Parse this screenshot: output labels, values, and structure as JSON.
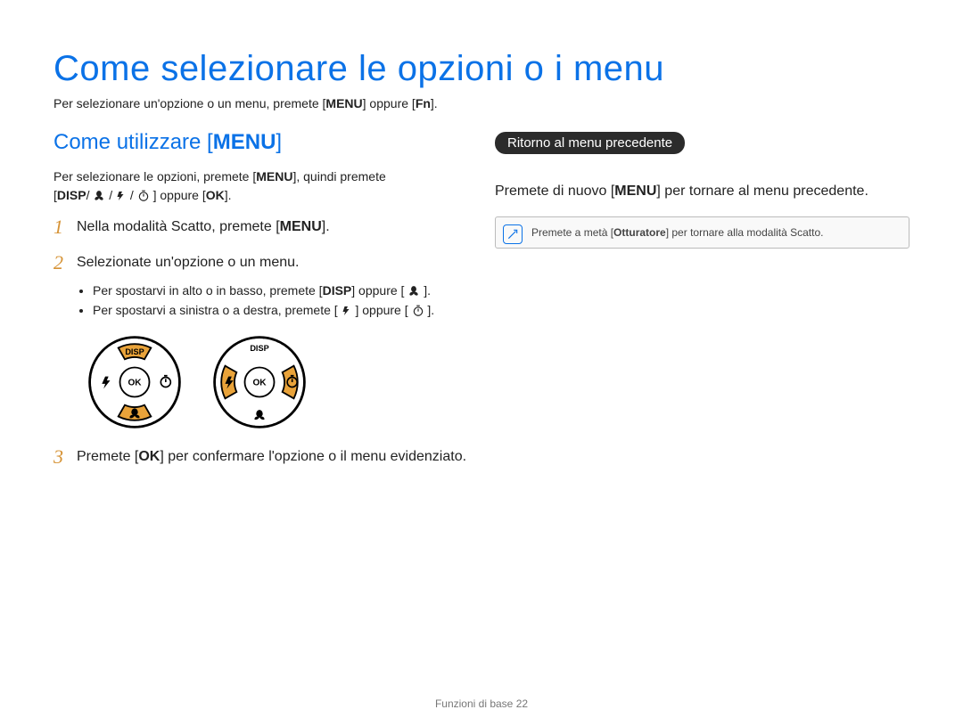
{
  "title": "Come selezionare le opzioni o i menu",
  "intro_a": "Per selezionare un'opzione o un menu, premete [",
  "intro_menu": "MENU",
  "intro_b": "] oppure [",
  "intro_fn": "Fn",
  "intro_c": "].",
  "left": {
    "heading_a": "Come utilizzare [",
    "heading_menu": "MENU",
    "heading_b": "]",
    "desc_a": "Per selezionare le opzioni, premete [",
    "desc_menu": "MENU",
    "desc_b": "], quindi premete",
    "desc_line2_a": "[",
    "desc_line2_disp": "DISP",
    "desc_line2_b": "/",
    "desc_line2_c": "/",
    "desc_line2_d": "/",
    "desc_line2_e": "] oppure [",
    "desc_line2_ok": "OK",
    "desc_line2_f": "].",
    "step1_num": "1",
    "step1_a": "Nella modalità Scatto, premete [",
    "step1_menu": "MENU",
    "step1_b": "].",
    "step2_num": "2",
    "step2": "Selezionate un'opzione o un menu.",
    "step2_sub1_a": "Per spostarvi in alto o in basso, premete [",
    "step2_sub1_disp": "DISP",
    "step2_sub1_b": "] oppure [",
    "step2_sub1_c": "].",
    "step2_sub2_a": "Per spostarvi a sinistra o a destra, premete [",
    "step2_sub2_b": "] oppure [",
    "step2_sub2_c": "].",
    "step3_num": "3",
    "step3_a": "Premete [",
    "step3_ok": "OK",
    "step3_b": "] per confermare l'opzione o il menu evidenziato.",
    "dial_disp": "DISP",
    "dial_ok": "OK"
  },
  "right": {
    "pill": "Ritorno al menu precedente",
    "line_a": "Premete di nuovo [",
    "line_menu": "MENU",
    "line_b": "] per tornare al menu precedente.",
    "note_a": "Premete a metà [",
    "note_bold": "Otturatore",
    "note_b": "] per tornare alla modalità Scatto."
  },
  "footer_a": "Funzioni di base  ",
  "footer_page": "22"
}
